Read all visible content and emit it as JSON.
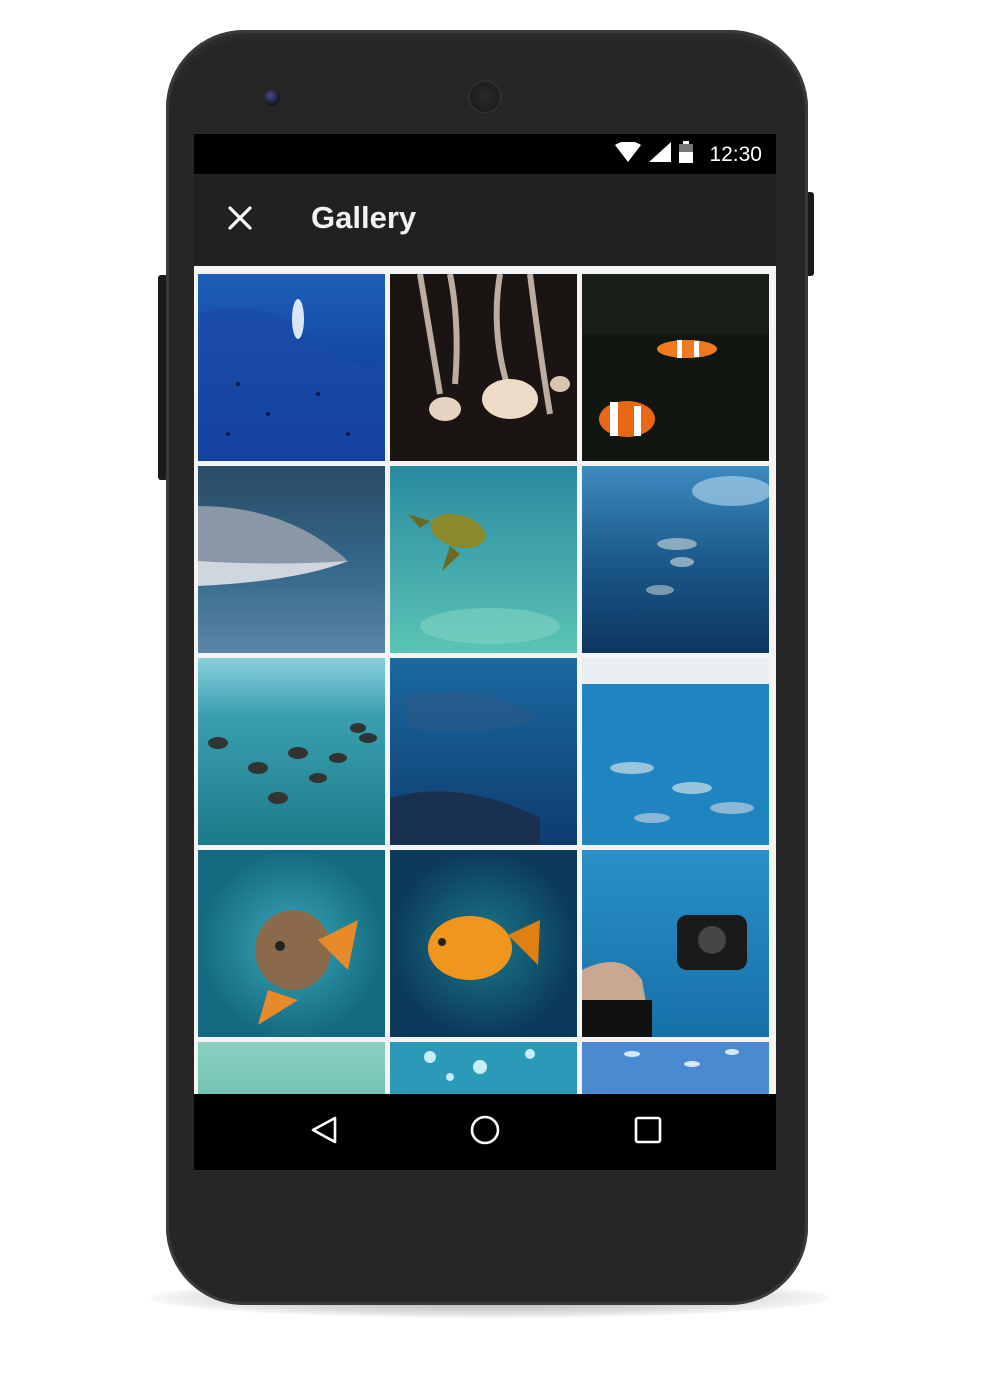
{
  "status_bar": {
    "time": "12:30",
    "icons": [
      "wifi-icon",
      "cell-signal-icon",
      "battery-icon"
    ]
  },
  "app_bar": {
    "title": "Gallery",
    "close_icon": "close-icon"
  },
  "gallery": {
    "photos": [
      {
        "subject": "diver"
      },
      {
        "subject": "jellyfish"
      },
      {
        "subject": "clownfish"
      },
      {
        "subject": "shark"
      },
      {
        "subject": "sea-turtle"
      },
      {
        "subject": "dolphins"
      },
      {
        "subject": "striped-fish-school"
      },
      {
        "subject": "whale-shark"
      },
      {
        "subject": "fish-school"
      },
      {
        "subject": "grouper"
      },
      {
        "subject": "orange-fish"
      },
      {
        "subject": "underwater-camera"
      },
      {
        "subject": "shallow-water"
      },
      {
        "subject": "bubbles"
      },
      {
        "subject": "small-fish"
      }
    ]
  },
  "nav_bar": {
    "buttons": [
      "back-icon",
      "home-icon",
      "recents-icon"
    ]
  },
  "colors": {
    "phone_body": "#262626",
    "app_bar": "#212121",
    "status_bar": "#000000",
    "gallery_bg": "#f4f4f4",
    "title_text": "#f2f2f2"
  }
}
